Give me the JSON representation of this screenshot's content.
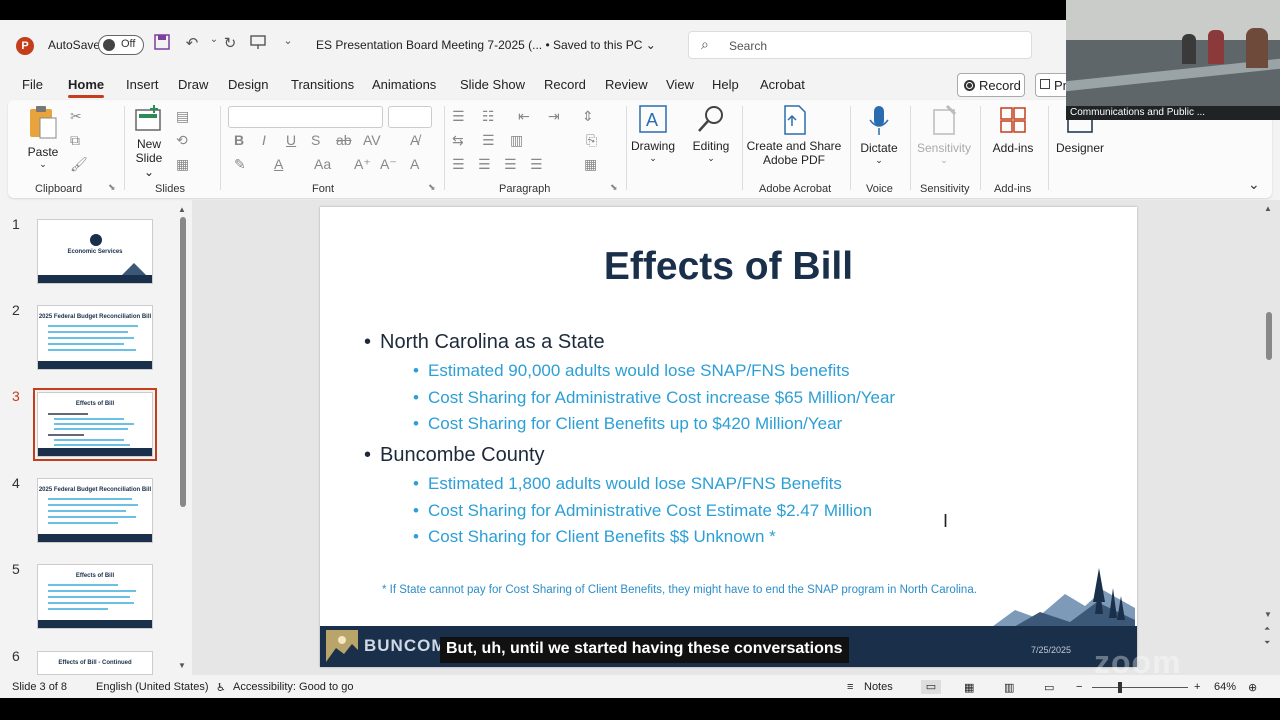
{
  "titlebar": {
    "app_logo": "P",
    "autosave_label": "AutoSave",
    "autosave_state": "Off",
    "doc_title": "ES Presentation Board Meeting 7-2025 (...  •  Saved to this PC ⌄",
    "search_placeholder": "Search"
  },
  "menu": {
    "tabs": [
      "File",
      "Home",
      "Insert",
      "Draw",
      "Design",
      "Transitions",
      "Animations",
      "Slide Show",
      "Record",
      "Review",
      "View",
      "Help",
      "Acrobat"
    ],
    "active": "Home",
    "record_button": "Record",
    "present_button": "Pr"
  },
  "ribbon": {
    "paste": "Paste",
    "new_slide_line1": "New",
    "new_slide_line2": "Slide ⌄",
    "drawing": "Drawing",
    "editing": "Editing",
    "create_share_line1": "Create and Share",
    "create_share_line2": "Adobe PDF",
    "dictate": "Dictate",
    "sensitivity": "Sensitivity",
    "addins": "Add-ins",
    "designer": "Designer",
    "groups": {
      "clipboard": "Clipboard",
      "slides": "Slides",
      "font": "Font",
      "paragraph": "Paragraph",
      "adobe_acrobat": "Adobe Acrobat",
      "voice": "Voice",
      "sensitivity": "Sensitivity",
      "addins": "Add-ins"
    }
  },
  "thumbnails": [
    {
      "num": "1",
      "title": "Economic Services"
    },
    {
      "num": "2",
      "title": "2025 Federal Budget Reconciliation Bill"
    },
    {
      "num": "3",
      "title": "Effects of Bill"
    },
    {
      "num": "4",
      "title": "2025 Federal Budget Reconciliation Bill"
    },
    {
      "num": "5",
      "title": "Effects of Bill"
    },
    {
      "num": "6",
      "title": "Effects of Bill - Continued"
    }
  ],
  "slide": {
    "title": "Effects of Bill",
    "section1": "North Carolina as a State",
    "s1_items": [
      "Estimated 90,000 adults would lose SNAP/FNS benefits",
      "Cost Sharing for Administrative Cost increase $65 Million/Year",
      "Cost Sharing for Client Benefits up to $420 Million/Year"
    ],
    "section2": "Buncombe County",
    "s2_items": [
      "Estimated 1,800 adults would lose SNAP/FNS Benefits",
      "Cost Sharing for Administrative Cost Estimate $2.47 Million",
      "Cost Sharing for Client Benefits $$ Unknown *"
    ],
    "footnote": "* If State cannot pay for Cost Sharing of Client Benefits, they might have to end the SNAP program in North Carolina.",
    "footer_brand": "BUNCOM",
    "footer_date": "7/25/2025"
  },
  "caption": "But, uh, until we started having these conversations",
  "watermark": "zoom",
  "video": {
    "name": "Communications and Public ..."
  },
  "status": {
    "slide_info": "Slide 3 of 8",
    "language": "English (United States)",
    "accessibility": "Accessibility: Good to go",
    "notes": "Notes",
    "zoom": "64%"
  }
}
